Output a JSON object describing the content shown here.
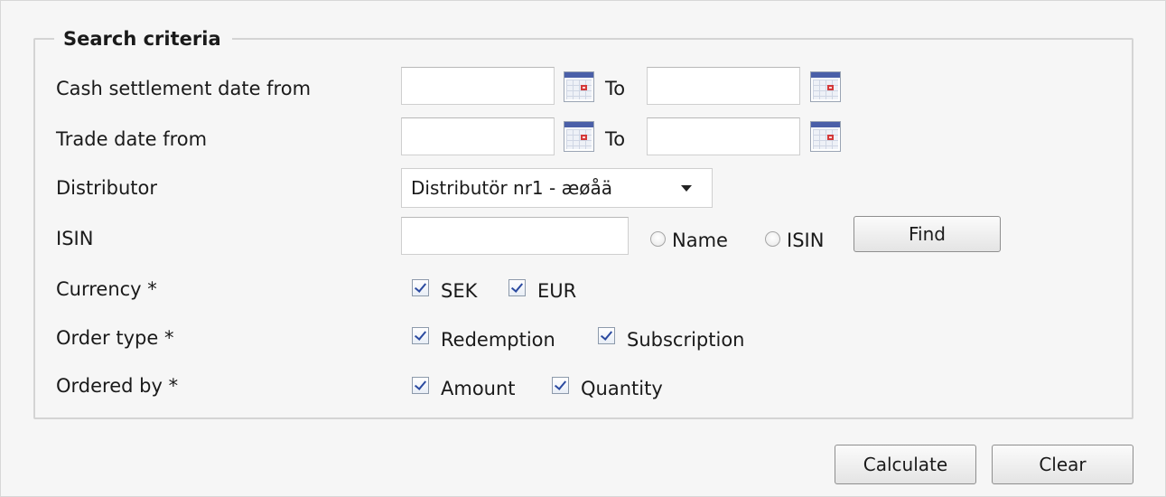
{
  "form": {
    "legend": "Search criteria",
    "cash_settlement": {
      "label": "Cash settlement date from",
      "from_value": "",
      "to_label": "To",
      "to_value": ""
    },
    "trade_date": {
      "label": "Trade date from",
      "from_value": "",
      "to_label": "To",
      "to_value": ""
    },
    "distributor": {
      "label": "Distributor",
      "selected": "Distributör nr1 - æøåä"
    },
    "isin": {
      "label": "ISIN",
      "value": "",
      "radio_name_label": "Name",
      "radio_isin_label": "ISIN",
      "find_label": "Find"
    },
    "currency": {
      "label": "Currency *",
      "options": [
        "SEK",
        "EUR"
      ]
    },
    "order_type": {
      "label": "Order type *",
      "options": [
        "Redemption",
        "Subscription"
      ]
    },
    "ordered_by": {
      "label": "Ordered by *",
      "options": [
        "Amount",
        "Quantity"
      ]
    }
  },
  "actions": {
    "calculate_label": "Calculate",
    "clear_label": "Clear"
  }
}
